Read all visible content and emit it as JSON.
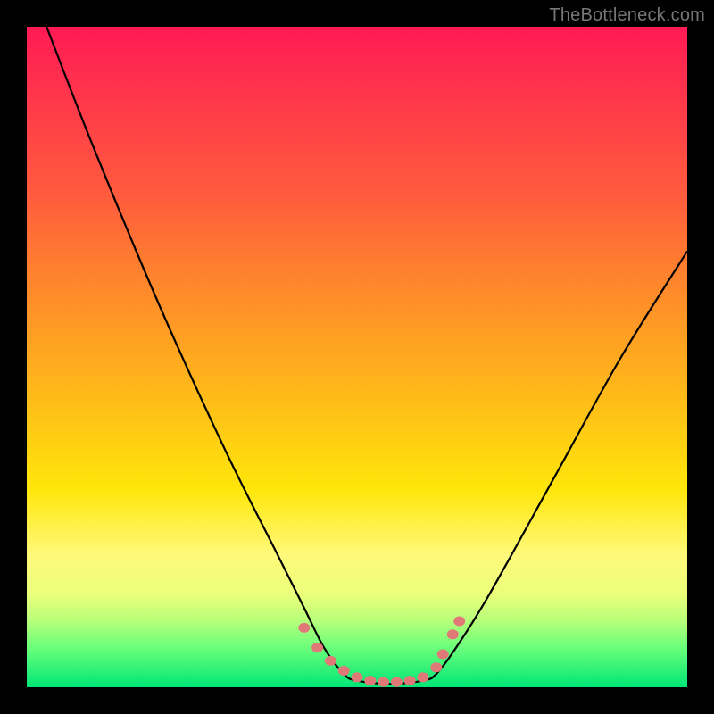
{
  "watermark": "TheBottleneck.com",
  "colors": {
    "frame": "#000000",
    "marker": "#e07878",
    "curve": "#000000",
    "gradient_top": "#ff1a54",
    "gradient_bottom": "#00e676"
  },
  "chart_data": {
    "type": "line",
    "title": "",
    "xlabel": "",
    "ylabel": "",
    "xlim": [
      0,
      100
    ],
    "ylim": [
      0,
      100
    ],
    "grid": false,
    "legend": false,
    "note": "V-shaped bottleneck curve. No numeric axes shown; x and values are estimated from gridless pixel position on a 0–100 scale. Minimum plateau ≈ x 48–62.",
    "series": [
      {
        "name": "curve",
        "x": [
          3,
          10,
          20,
          30,
          38,
          42,
          45,
          48,
          50,
          55,
          60,
          62,
          65,
          70,
          80,
          90,
          100
        ],
        "values": [
          100,
          82,
          58,
          36,
          20,
          12,
          6,
          2,
          1,
          0.5,
          1,
          2,
          6,
          14,
          32,
          50,
          66
        ]
      }
    ],
    "markers": {
      "name": "highlighted-points",
      "points": [
        {
          "x": 42,
          "y": 9
        },
        {
          "x": 44,
          "y": 6
        },
        {
          "x": 46,
          "y": 4
        },
        {
          "x": 48,
          "y": 2.5
        },
        {
          "x": 50,
          "y": 1.5
        },
        {
          "x": 52,
          "y": 1
        },
        {
          "x": 54,
          "y": 0.8
        },
        {
          "x": 56,
          "y": 0.8
        },
        {
          "x": 58,
          "y": 1
        },
        {
          "x": 60,
          "y": 1.5
        },
        {
          "x": 62,
          "y": 3
        },
        {
          "x": 63,
          "y": 5
        },
        {
          "x": 64.5,
          "y": 8
        },
        {
          "x": 65.5,
          "y": 10
        }
      ]
    }
  }
}
